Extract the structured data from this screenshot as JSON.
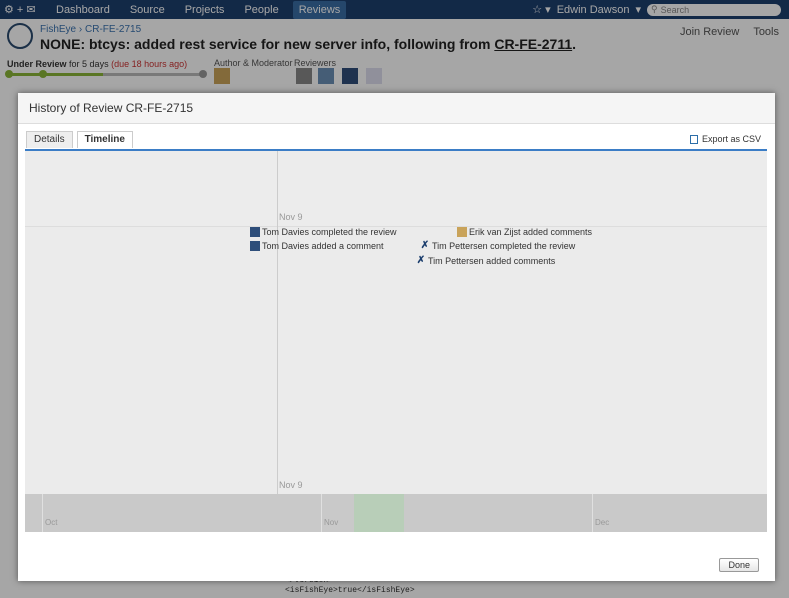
{
  "nav": {
    "items": [
      "Dashboard",
      "Source",
      "Projects",
      "People",
      "Reviews"
    ],
    "active": "Reviews",
    "user": "Edwin Dawson",
    "search_placeholder": "Search"
  },
  "review": {
    "breadcrumb": [
      "FishEye",
      "CR-FE-2715"
    ],
    "title_prefix": "NONE: btcys: added rest service for new server info, following from",
    "title_link": "CR-FE-2711",
    "title_suffix": ".",
    "status_label": "Under Review",
    "status_duration": "for 5 days",
    "status_due": "(due 18 hours ago)",
    "author_label": "Author & Moderator",
    "reviewers_label": "Reviewers",
    "join_label": "Join Review",
    "tools_label": "Tools",
    "code_lines": [
      "</version>",
      "<isFishEye>true</isFishEye>"
    ]
  },
  "dialog": {
    "title": "History of Review CR-FE-2715",
    "tabs": [
      "Details",
      "Timeline"
    ],
    "active_tab": "Timeline",
    "export_label": "Export as CSV",
    "date_top": "Nov 9",
    "date_bottom": "Nov 9",
    "events": [
      {
        "text": "Tom Davies completed the review",
        "icon": "tom"
      },
      {
        "text": "Tom Davies added a comment",
        "icon": "tom"
      },
      {
        "text": "Erik van Zijst added comments",
        "icon": "erik"
      },
      {
        "text": "Tim Pettersen completed the review",
        "icon": "tim"
      },
      {
        "text": "Tim Pettersen added comments",
        "icon": "tim"
      }
    ],
    "months": [
      "Oct",
      "Nov",
      "Dec"
    ],
    "done_label": "Done"
  },
  "colors": {
    "nav_bg": "#1d3f6e",
    "accent": "#3b7dc6",
    "progress": "#8ab638",
    "due": "#cc3333"
  }
}
